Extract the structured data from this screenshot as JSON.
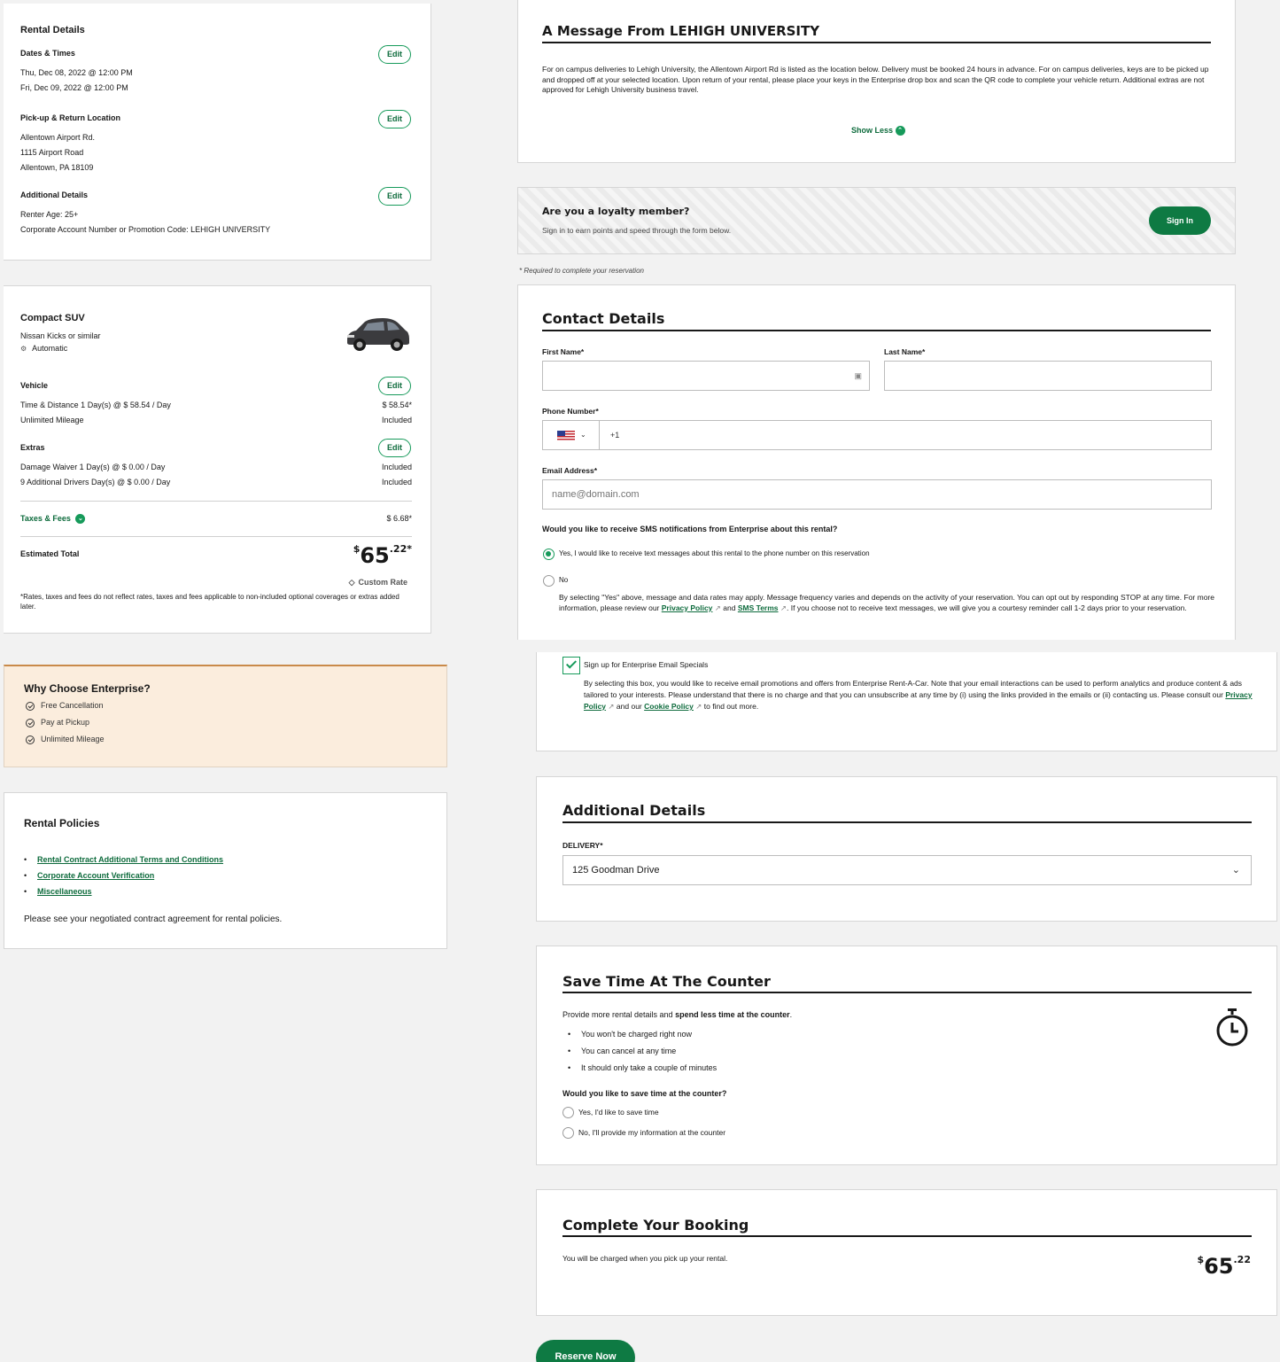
{
  "rental_details": {
    "title": "Rental Details",
    "dates_label": "Dates & Times",
    "pickup_datetime": "Thu, Dec 08, 2022 @ 12:00 PM",
    "return_datetime": "Fri, Dec 09, 2022 @ 12:00 PM",
    "location_label": "Pick-up & Return Location",
    "location_line1": "Allentown Airport Rd.",
    "location_line2": "1115 Airport Road",
    "location_line3": "Allentown, PA 18109",
    "additional_label": "Additional Details",
    "renter_age": "Renter Age: 25+",
    "corporate_code": "Corporate Account Number or Promotion Code: LEHIGH UNIVERSITY",
    "edit_label": "Edit"
  },
  "vehicle_summary": {
    "class": "Compact SUV",
    "model": "Nissan Kicks or similar",
    "transmission": "Automatic",
    "vehicle_label": "Vehicle",
    "time_distance": "Time & Distance 1 Day(s) @ $ 58.54 / Day",
    "time_distance_price": "$ 58.54*",
    "mileage": "Unlimited Mileage",
    "mileage_price": "Included",
    "extras_label": "Extras",
    "damage_waiver": "Damage Waiver 1 Day(s) @ $ 0.00 / Day",
    "damage_waiver_price": "Included",
    "additional_drivers": "9 Additional Drivers Day(s) @ $ 0.00 / Day",
    "additional_drivers_price": "Included",
    "taxes_label": "Taxes & Fees",
    "taxes_price": "$ 6.68*",
    "total_label": "Estimated Total",
    "total_currency": "$",
    "total_dollars": "65",
    "total_cents": ".22*",
    "custom_rate": "Custom Rate",
    "disclaimer": "*Rates, taxes and fees do not reflect rates, taxes and fees applicable to non-included optional coverages or extras added later.",
    "edit_label": "Edit"
  },
  "why_enterprise": {
    "title": "Why Choose Enterprise?",
    "items": [
      "Free Cancellation",
      "Pay at Pickup",
      "Unlimited Mileage"
    ]
  },
  "rental_policies": {
    "title": "Rental Policies",
    "links": [
      "Rental Contract Additional Terms and Conditions",
      "Corporate Account Verification",
      "Miscellaneous"
    ],
    "note": "Please see your negotiated contract agreement for rental policies."
  },
  "message": {
    "title": "A Message From LEHIGH UNIVERSITY",
    "body": "For on campus deliveries to Lehigh University, the Allentown Airport Rd is listed as the location below. Delivery must be booked 24 hours in advance. For on campus deliveries, keys are to be picked up and dropped off at your selected location. Upon return of your rental, please place your keys in the Enterprise drop box and scan the QR code to complete your vehicle return. Additional extras are not approved for Lehigh University business travel.",
    "show_less": "Show Less"
  },
  "loyalty": {
    "title": "Are you a loyalty member?",
    "subtitle": "Sign in to earn points and speed through the form below.",
    "sign_in": "Sign In"
  },
  "required_note": "* Required to complete your reservation",
  "contact": {
    "title": "Contact Details",
    "first_name_label": "First Name*",
    "last_name_label": "Last Name*",
    "phone_label": "Phone Number*",
    "phone_prefix": "+1",
    "email_label": "Email Address*",
    "email_placeholder": "name@domain.com",
    "sms_question": "Would you like to receive SMS notifications from Enterprise about this rental?",
    "sms_yes": "Yes, I would like to receive text messages about this rental to the phone number on this reservation",
    "sms_no": "No",
    "sms_disclaimer_1": "By selecting \"Yes\" above, message and data rates may apply. Message frequency varies and depends on the activity of your reservation. You can opt out by responding STOP at any time. For more information, please review our",
    "privacy_policy": "Privacy Policy",
    "and": "and",
    "sms_terms": "SMS Terms",
    "sms_disclaimer_2": ". If you choose not to receive text messages, we will give you a courtesy reminder call 1-2 days prior to your reservation.",
    "email_specials": "Sign up for Enterprise Email Specials",
    "email_disclaimer_1": "By selecting this box, you would like to receive email promotions and offers from Enterprise Rent-A-Car. Note that your email interactions can be used to perform analytics and produce content & ads tailored to your interests. Please understand that there is no charge and that you can unsubscribe at any time by (i) using the links provided in the emails or (ii) contacting us. Please consult our",
    "and_our": "and our",
    "cookie_policy": "Cookie Policy",
    "email_disclaimer_2": "to find out more."
  },
  "additional_details": {
    "title": "Additional Details",
    "delivery_label": "DELIVERY*",
    "delivery_value": "125 Goodman Drive"
  },
  "save_time": {
    "title": "Save Time At The Counter",
    "intro_1": "Provide more rental details and",
    "intro_bold": "spend less time at the counter",
    "intro_2": ".",
    "bullets": [
      "You won't be charged right now",
      "You can cancel at any time",
      "It should only take a couple of minutes"
    ],
    "question": "Would you like to save time at the counter?",
    "option_yes": "Yes, I'd like to save time",
    "option_no": "No, I'll provide my information at the counter"
  },
  "complete": {
    "title": "Complete Your Booking",
    "note": "You will be charged when you pick up your rental.",
    "currency": "$",
    "dollars": "65",
    "cents": ".22",
    "reserve_button": "Reserve Now"
  },
  "colors": {
    "brand_green": "#169a5a",
    "dark_green": "#0e7a43",
    "why_bg": "#fbeddd",
    "why_border": "#c98a4a"
  }
}
